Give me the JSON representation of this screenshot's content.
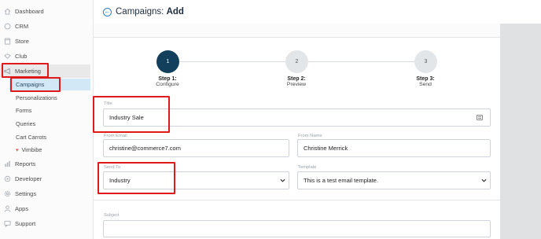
{
  "sidebar": {
    "items": [
      {
        "label": "Dashboard",
        "icon": "home-icon"
      },
      {
        "label": "CRM",
        "icon": "crm-icon"
      },
      {
        "label": "Store",
        "icon": "store-icon"
      },
      {
        "label": "Club",
        "icon": "club-icon"
      },
      {
        "label": "Marketing",
        "icon": "megaphone-icon"
      },
      {
        "label": "Reports",
        "icon": "reports-icon"
      },
      {
        "label": "Developer",
        "icon": "developer-icon"
      },
      {
        "label": "Settings",
        "icon": "gear-icon"
      },
      {
        "label": "Apps",
        "icon": "apps-icon"
      },
      {
        "label": "Support",
        "icon": "support-icon"
      }
    ],
    "marketing_sub": [
      {
        "label": "Campaigns"
      },
      {
        "label": "Personalizations"
      },
      {
        "label": "Forms"
      },
      {
        "label": "Queries"
      },
      {
        "label": "Cart Carrots"
      },
      {
        "label": "Vimbibe"
      }
    ]
  },
  "header": {
    "title_prefix": "Campaigns:",
    "title_action": "Add"
  },
  "stepper": {
    "steps": [
      {
        "number": "1",
        "label": "Step 1:",
        "sub": "Configure",
        "state": "active"
      },
      {
        "number": "2",
        "label": "Step 2:",
        "sub": "Preview",
        "state": "pending"
      },
      {
        "number": "3",
        "label": "Step 3:",
        "sub": "Send",
        "state": "pending"
      }
    ]
  },
  "form": {
    "title_label": "Title",
    "title_value": "Industry Sale",
    "from_email_label": "From Email",
    "from_email_value": "christine@commerce7.com",
    "from_name_label": "From Name",
    "from_name_value": "Christine Merrick",
    "send_to_label": "Send To",
    "send_to_value": "Industry",
    "template_label": "Template",
    "template_value": "This is a test email template.",
    "subject_label": "Subject",
    "subject_value": ""
  },
  "colors": {
    "highlight_box": "#e01a1a",
    "active_step": "#123f5c",
    "active_subitem_bg": "#d3e8f7",
    "back_icon": "#2f7ec2"
  }
}
